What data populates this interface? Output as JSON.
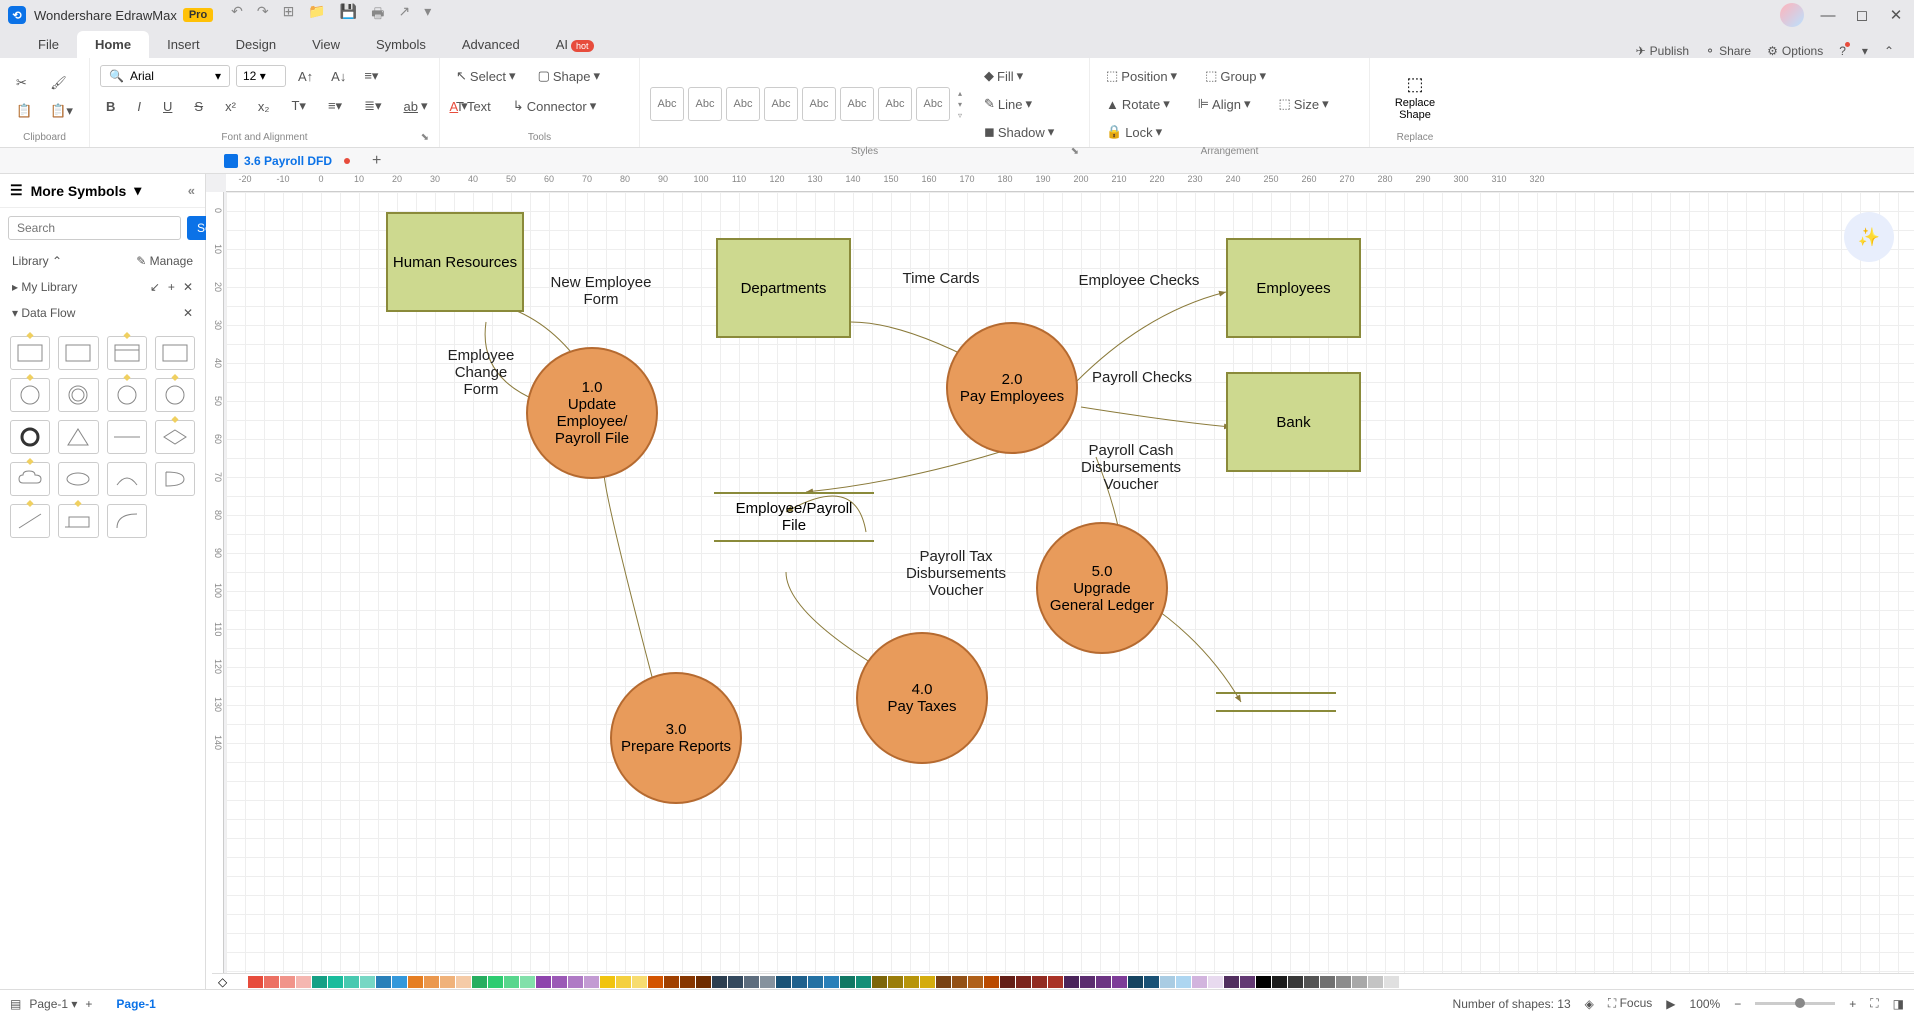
{
  "app": {
    "title": "Wondershare EdrawMax",
    "badge": "Pro"
  },
  "menu": {
    "tabs": [
      "File",
      "Home",
      "Insert",
      "Design",
      "View",
      "Symbols",
      "Advanced",
      "AI"
    ],
    "active": "Home",
    "ai_badge": "hot",
    "right": {
      "publish": "Publish",
      "share": "Share",
      "options": "Options"
    }
  },
  "ribbon": {
    "clipboard_label": "Clipboard",
    "font_label": "Font and Alignment",
    "font_name": "Arial",
    "font_size": "12",
    "tools_label": "Tools",
    "select": "Select",
    "shape": "Shape",
    "text": "Text",
    "connector": "Connector",
    "styles_label": "Styles",
    "style_swatch": "Abc",
    "fill": "Fill",
    "line": "Line",
    "shadow": "Shadow",
    "arrangement_label": "Arrangement",
    "position": "Position",
    "group": "Group",
    "rotate": "Rotate",
    "align": "Align",
    "size": "Size",
    "lock": "Lock",
    "replace_label": "Replace",
    "replace_shape": "Replace Shape"
  },
  "doc": {
    "tab_name": "3.6 Payroll DFD",
    "add": "+"
  },
  "sidebar": {
    "title": "More Symbols",
    "search_placeholder": "Search",
    "search_btn": "Search",
    "library": "Library",
    "manage": "Manage",
    "my_library": "My Library",
    "data_flow": "Data Flow"
  },
  "ruler": {
    "h": [
      "-20",
      "-10",
      "0",
      "10",
      "20",
      "30",
      "40",
      "50",
      "60",
      "70",
      "80",
      "90",
      "100",
      "110",
      "120",
      "130",
      "140",
      "150",
      "160",
      "170",
      "180",
      "190",
      "200",
      "210",
      "220",
      "230",
      "240",
      "250",
      "260",
      "270",
      "280",
      "290",
      "300",
      "310",
      "320"
    ],
    "v": [
      "0",
      "10",
      "20",
      "30",
      "40",
      "50",
      "60",
      "70",
      "80",
      "90",
      "100",
      "110",
      "120",
      "130",
      "140"
    ]
  },
  "diagram": {
    "entities": {
      "hr": "Human Resources",
      "departments": "Departments",
      "employees": "Employees",
      "bank": "Bank"
    },
    "processes": {
      "p1": "1.0\nUpdate Employee/ Payroll File",
      "p2": "2.0\nPay Employees",
      "p3": "3.0\nPrepare Reports",
      "p4": "4.0\nPay Taxes",
      "p5": "5.0\nUpgrade General Ledger"
    },
    "datastore": "Employee/Payroll File",
    "flows": {
      "new_emp": "New Employee Form",
      "emp_change": "Employee Change Form",
      "time_cards": "Time Cards",
      "emp_checks": "Employee Checks",
      "payroll_checks": "Payroll Checks",
      "cash_voucher": "Payroll Cash Disbursements Voucher",
      "tax_voucher": "Payroll Tax Disbursements Voucher"
    }
  },
  "colorbar": [
    "#ffffff",
    "#e74c3c",
    "#ec7063",
    "#f1948a",
    "#f5b7b1",
    "#16a085",
    "#1abc9c",
    "#48c9b0",
    "#76d7c4",
    "#2980b9",
    "#3498db",
    "#e67e22",
    "#eb984e",
    "#f0b27a",
    "#f5cba7",
    "#27ae60",
    "#2ecc71",
    "#58d68d",
    "#82e0aa",
    "#8e44ad",
    "#9b59b6",
    "#af7ac5",
    "#c39bd3",
    "#f1c40f",
    "#f4d03f",
    "#f7dc6f",
    "#d35400",
    "#a04000",
    "#873600",
    "#6e2c00",
    "#2c3e50",
    "#34495e",
    "#5d6d7e",
    "#85929e",
    "#1a5276",
    "#1f618d",
    "#2471a3",
    "#2980b9",
    "#117864",
    "#148f77",
    "#7d6608",
    "#9a7d0a",
    "#b7950b",
    "#d4ac0d",
    "#784212",
    "#935116",
    "#af601a",
    "#ba4a00",
    "#641e16",
    "#7b241c",
    "#922b21",
    "#a93226",
    "#4a235a",
    "#5b2c6f",
    "#6c3483",
    "#7d3c98",
    "#154360",
    "#1a5276",
    "#a9cce3",
    "#aed6f1",
    "#d2b4de",
    "#e8daef",
    "#512e5f",
    "#633974",
    "#000000",
    "#1c1c1c",
    "#383838",
    "#545454",
    "#707070",
    "#8c8c8c",
    "#a8a8a8",
    "#c4c4c4",
    "#e0e0e0"
  ],
  "status": {
    "page_label": "Page-1",
    "page_tab": "Page-1",
    "shapes": "Number of shapes: 13",
    "focus": "Focus",
    "zoom": "100%"
  }
}
